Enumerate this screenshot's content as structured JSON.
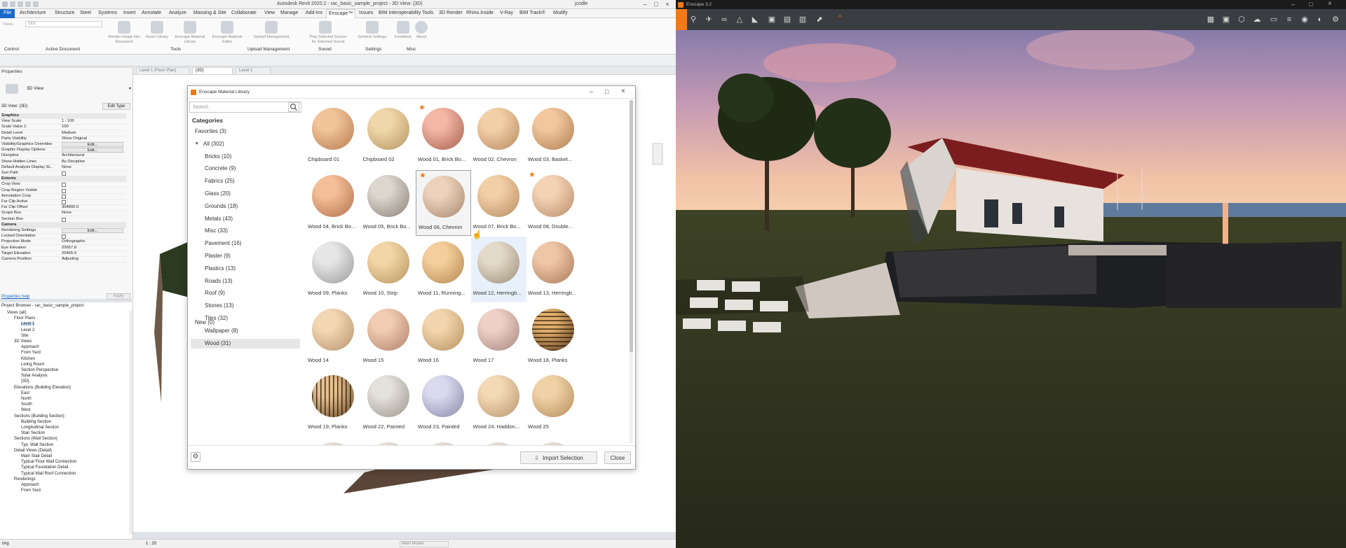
{
  "revit": {
    "title": "Autodesk Revit 2020.2 - rac_basic_sample_project - 3D View: {3D}",
    "user": "jcodle",
    "tabs": [
      "File",
      "Architecture",
      "Structure",
      "Steel",
      "Systems",
      "Insert",
      "Annotate",
      "Analyze",
      "Massing & Site",
      "Collaborate",
      "View",
      "Manage",
      "Add-Ins",
      "Enscape™",
      "Issues",
      "BIM Interoperability Tools",
      "3D Render",
      "Rhino.Inside",
      "V-Ray",
      "BIM Track®",
      "Modify"
    ],
    "active_tab": "Enscape™",
    "ribbon_groups": [
      "Control",
      "Active Document",
      "Tools",
      "Upload Management",
      "Sound",
      "Settings",
      "Misc"
    ],
    "ribbon_buttons": [
      "Render Image into Document",
      "Asset Library",
      "Enscape Material Library",
      "Enscape Material Editor",
      "Upload Management",
      "Play Selected Source for Selected Sound",
      "General Settings",
      "Feedback",
      "About"
    ],
    "view_name_field": "{3D}",
    "statusbar": {
      "left": "img",
      "scale": "1 : 20",
      "model": "Main Model"
    }
  },
  "properties": {
    "title": "Properties",
    "type_name": "3D View",
    "instance_label": "3D View: {3D}",
    "edit_type": "Edit Type",
    "rows": [
      {
        "k": "Graphics",
        "v": "",
        "kind": "sec"
      },
      {
        "k": "View Scale",
        "v": "1 : 100",
        "kind": "val"
      },
      {
        "k": "Scale Value 1:",
        "v": "100",
        "kind": "val"
      },
      {
        "k": "Detail Level",
        "v": "Medium",
        "kind": "val"
      },
      {
        "k": "Parts Visibility",
        "v": "Show Original",
        "kind": "val"
      },
      {
        "k": "Visibility/Graphics Overrides",
        "v": "Edit...",
        "kind": "btn"
      },
      {
        "k": "Graphic Display Options",
        "v": "Edit...",
        "kind": "btn"
      },
      {
        "k": "Discipline",
        "v": "Architectural",
        "kind": "val"
      },
      {
        "k": "Show Hidden Lines",
        "v": "By Discipline",
        "kind": "val"
      },
      {
        "k": "Default Analysis Display St...",
        "v": "None",
        "kind": "val"
      },
      {
        "k": "Sun Path",
        "v": "",
        "kind": "cb"
      },
      {
        "k": "Extents",
        "v": "",
        "kind": "sec"
      },
      {
        "k": "Crop View",
        "v": "",
        "kind": "cb"
      },
      {
        "k": "Crop Region Visible",
        "v": "",
        "kind": "cb"
      },
      {
        "k": "Annotation Crop",
        "v": "",
        "kind": "cb"
      },
      {
        "k": "Far Clip Active",
        "v": "",
        "kind": "cb"
      },
      {
        "k": "Far Clip Offset",
        "v": "304800.0",
        "kind": "val"
      },
      {
        "k": "Scope Box",
        "v": "None",
        "kind": "val"
      },
      {
        "k": "Section Box",
        "v": "",
        "kind": "cb"
      },
      {
        "k": "Camera",
        "v": "",
        "kind": "sec"
      },
      {
        "k": "Rendering Settings",
        "v": "Edit...",
        "kind": "btn"
      },
      {
        "k": "Locked Orientation",
        "v": "",
        "kind": "cb"
      },
      {
        "k": "Projection Mode",
        "v": "Orthographic",
        "kind": "val"
      },
      {
        "k": "Eye Elevation",
        "v": "20657.8",
        "kind": "val"
      },
      {
        "k": "Target Elevation",
        "v": "20465.9",
        "kind": "val"
      },
      {
        "k": "Camera Position",
        "v": "Adjusting",
        "kind": "val"
      }
    ],
    "help_link": "Properties help",
    "apply": "Apply"
  },
  "browser": {
    "title": "Project Browser - rac_basic_sample_project",
    "items": [
      {
        "t": "Views (all)",
        "d": 0
      },
      {
        "t": "Floor Plans",
        "d": 1
      },
      {
        "t": "Level 1",
        "d": 2,
        "sel": true
      },
      {
        "t": "Level 2",
        "d": 2
      },
      {
        "t": "Site",
        "d": 2
      },
      {
        "t": "3D Views",
        "d": 1
      },
      {
        "t": "Approach",
        "d": 2
      },
      {
        "t": "From Yard",
        "d": 2
      },
      {
        "t": "Kitchen",
        "d": 2
      },
      {
        "t": "Living Room",
        "d": 2
      },
      {
        "t": "Section Perspective",
        "d": 2
      },
      {
        "t": "Solar Analysis",
        "d": 2
      },
      {
        "t": "{3D}",
        "d": 2
      },
      {
        "t": "Elevations (Building Elevation)",
        "d": 1
      },
      {
        "t": "East",
        "d": 2
      },
      {
        "t": "North",
        "d": 2
      },
      {
        "t": "South",
        "d": 2
      },
      {
        "t": "West",
        "d": 2
      },
      {
        "t": "Sections (Building Section)",
        "d": 1
      },
      {
        "t": "Building Section",
        "d": 2
      },
      {
        "t": "Longitudinal Section",
        "d": 2
      },
      {
        "t": "Stair Section",
        "d": 2
      },
      {
        "t": "Sections (Wall Section)",
        "d": 1
      },
      {
        "t": "Typ. Wall Section",
        "d": 2
      },
      {
        "t": "Detail Views (Detail)",
        "d": 1
      },
      {
        "t": "Main Stair Detail",
        "d": 2
      },
      {
        "t": "Typical Floor Wall Connection",
        "d": 2
      },
      {
        "t": "Typical Foundation Detail",
        "d": 2
      },
      {
        "t": "Typical Wall Roof Connection",
        "d": 2
      },
      {
        "t": "Renderings",
        "d": 1
      },
      {
        "t": "Approach",
        "d": 2
      },
      {
        "t": "From Yard",
        "d": 2
      }
    ]
  },
  "view_tabs": [
    "Level 1 (Floor Plan)",
    "{3D}",
    "Level 1"
  ],
  "dialog": {
    "title": "Enscape Material Library",
    "search_placeholder": "Search",
    "categories_title": "Categories",
    "categories": [
      {
        "label": "Favorites (3)",
        "indent": 0
      },
      {
        "label": "All (302)",
        "indent": 1,
        "arrow": true
      },
      {
        "label": "Bricks (10)",
        "indent": 2
      },
      {
        "label": "Concrete (9)",
        "indent": 2
      },
      {
        "label": "Fabrics (25)",
        "indent": 2
      },
      {
        "label": "Glass (20)",
        "indent": 2
      },
      {
        "label": "Grounds (18)",
        "indent": 2
      },
      {
        "label": "Metals (43)",
        "indent": 2
      },
      {
        "label": "Misc (33)",
        "indent": 2
      },
      {
        "label": "Pavement (16)",
        "indent": 2
      },
      {
        "label": "Plaster (9)",
        "indent": 2
      },
      {
        "label": "Plastics (13)",
        "indent": 2
      },
      {
        "label": "Roads (13)",
        "indent": 2
      },
      {
        "label": "Roof (9)",
        "indent": 2
      },
      {
        "label": "Stones (13)",
        "indent": 2
      },
      {
        "label": "Tiles (32)",
        "indent": 2
      },
      {
        "label": "Wallpaper (8)",
        "indent": 2
      },
      {
        "label": "Wood (31)",
        "indent": 2,
        "sel": true
      },
      {
        "label": "New (0)",
        "indent": 0
      }
    ],
    "materials": [
      {
        "label": "Chipboard 01",
        "fav": false,
        "c1": "#f1c49a",
        "c2": "#b77b4f"
      },
      {
        "label": "Chipboard 02",
        "fav": false,
        "c1": "#f0d7a9",
        "c2": "#b69563"
      },
      {
        "label": "Wood 01, Brick Bo...",
        "fav": true,
        "c1": "#f3b7a5",
        "c2": "#a85e4c"
      },
      {
        "label": "Wood 02, Chevron",
        "fav": false,
        "c1": "#f3cfa8",
        "c2": "#b78a5e"
      },
      {
        "label": "Wood 03, Basket...",
        "fav": false,
        "c1": "#f2c79e",
        "c2": "#b07e52"
      },
      {
        "label": "Wood 04, Brick Bo...",
        "fav": false,
        "c1": "#f4bf98",
        "c2": "#b0704a"
      },
      {
        "label": "Wood 05, Brick Bo...",
        "fav": false,
        "c1": "#dcd6cf",
        "c2": "#8b8074"
      },
      {
        "label": "Wood 06, Chevron",
        "fav": true,
        "c1": "#ecd2bd",
        "c2": "#a9886c",
        "sel": true
      },
      {
        "label": "Wood 07, Brick Bo...",
        "fav": false,
        "c1": "#f3cfa7",
        "c2": "#b88c61"
      },
      {
        "label": "Wood 08, Double...",
        "fav": true,
        "c1": "#f4d3b5",
        "c2": "#b98c6a"
      },
      {
        "label": "Wood 09, Planks",
        "fav": false,
        "c1": "#e6e6e6",
        "c2": "#9a9a9a"
      },
      {
        "label": "Wood 10, Strip",
        "fav": false,
        "c1": "#f3d6a7",
        "c2": "#b69460"
      },
      {
        "label": "Wood 11, Running...",
        "fav": false,
        "c1": "#f4cf9c",
        "c2": "#b5884f"
      },
      {
        "label": "Wood 12, Herringb...",
        "fav": false,
        "c1": "#e4dac9",
        "c2": "#9c8e78",
        "hov": true
      },
      {
        "label": "Wood 13, Herringb...",
        "fav": false,
        "c1": "#efc6a6",
        "c2": "#a97a5a"
      },
      {
        "label": "Wood 14",
        "fav": false,
        "c1": "#f3d6b3",
        "c2": "#b5946d"
      },
      {
        "label": "Wood 15",
        "fav": false,
        "c1": "#f2cbb3",
        "c2": "#ad8267"
      },
      {
        "label": "Wood 16",
        "fav": false,
        "c1": "#f3d5ad",
        "c2": "#b5915f"
      },
      {
        "label": "Wood 17",
        "fav": false,
        "c1": "#efd0c6",
        "c2": "#a68780"
      },
      {
        "label": "Wood 18, Planks",
        "fav": false,
        "c1": "#e2ae6c",
        "c2": "#5a3b1e",
        "stripe": true
      },
      {
        "label": "Wood 19, Planks",
        "fav": false,
        "c1": "#e6c08e",
        "c2": "#6c4b2a",
        "stripev": true
      },
      {
        "label": "Wood 22, Painted",
        "fav": false,
        "c1": "#e4e0da",
        "c2": "#9a958c"
      },
      {
        "label": "Wood 23, Painted",
        "fav": false,
        "c1": "#dad9ee",
        "c2": "#8a89a9"
      },
      {
        "label": "Wood 24, Haddon...",
        "fav": false,
        "c1": "#f4d9b6",
        "c2": "#b8966d"
      },
      {
        "label": "Wood 25",
        "fav": false,
        "c1": "#f1d2a7",
        "c2": "#b48c5b"
      }
    ],
    "import_button": "Import Selection",
    "close_button": "Close"
  },
  "enscape": {
    "title": "Enscape 3.2",
    "toolbar_icons": [
      "home-icon",
      "walk-icon",
      "fly-icon",
      "binoculars-icon",
      "sun-icon",
      "section-icon",
      "image-icon",
      "batch-render-icon",
      "video-icon",
      "exe-export-icon",
      "bim-icon",
      "material-icon",
      "asset-library-icon",
      "upload-icon",
      "visual-settings-icon",
      "general-settings-icon"
    ]
  },
  "colors": {
    "accent": "#1b6ac9",
    "enscape_orange": "#f07a1a",
    "favorite_star": "#f07a1a"
  }
}
